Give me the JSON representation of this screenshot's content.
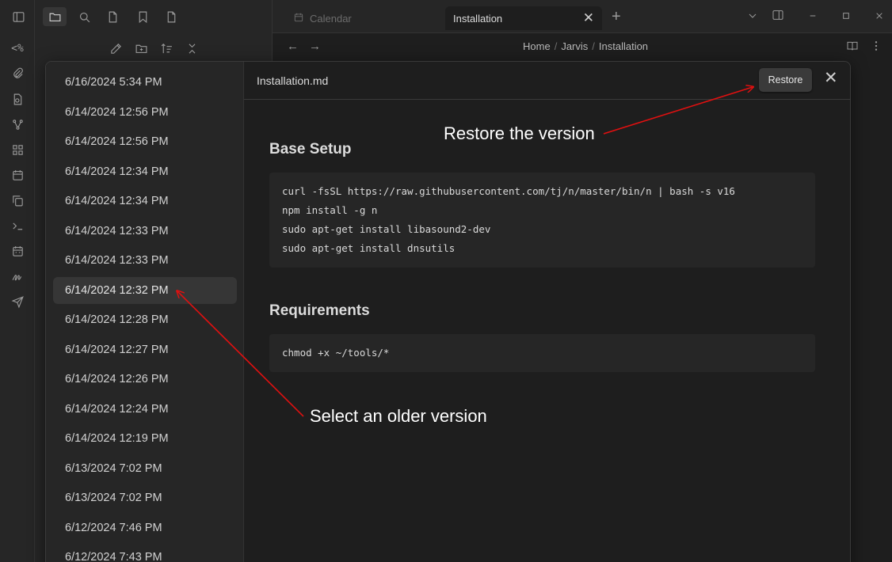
{
  "tabs": {
    "inactive_label": "Calendar",
    "active_label": "Installation",
    "close_glyph": "✕",
    "new_tab_glyph": "+"
  },
  "breadcrumb": [
    "Home",
    "Jarvis",
    "Installation"
  ],
  "ribbon": {
    "templater_label": "<%"
  },
  "modal": {
    "filename": "Installation.md",
    "restore_label": "Restore",
    "close_glyph": "✕",
    "versions": [
      "6/16/2024 5:34 PM",
      "6/14/2024 12:56 PM",
      "6/14/2024 12:56 PM",
      "6/14/2024 12:34 PM",
      "6/14/2024 12:34 PM",
      "6/14/2024 12:33 PM",
      "6/14/2024 12:33 PM",
      "6/14/2024 12:32 PM",
      "6/14/2024 12:28 PM",
      "6/14/2024 12:27 PM",
      "6/14/2024 12:26 PM",
      "6/14/2024 12:24 PM",
      "6/14/2024 12:19 PM",
      "6/13/2024 7:02 PM",
      "6/13/2024 7:02 PM",
      "6/12/2024 7:46 PM",
      "6/12/2024 7:43 PM"
    ],
    "selected_index": 7,
    "sections": [
      {
        "heading": "Base Setup",
        "code": [
          "curl -fsSL https://raw.githubusercontent.com/tj/n/master/bin/n | bash -s v16",
          "npm install -g n",
          "sudo apt-get install libasound2-dev",
          "sudo apt-get install dnsutils"
        ]
      },
      {
        "heading": "Requirements",
        "code": [
          "chmod +x ~/tools/*"
        ]
      }
    ]
  },
  "annotations": {
    "restore": "Restore the version",
    "select": "Select an older version",
    "arrow_color": "#e01010"
  }
}
